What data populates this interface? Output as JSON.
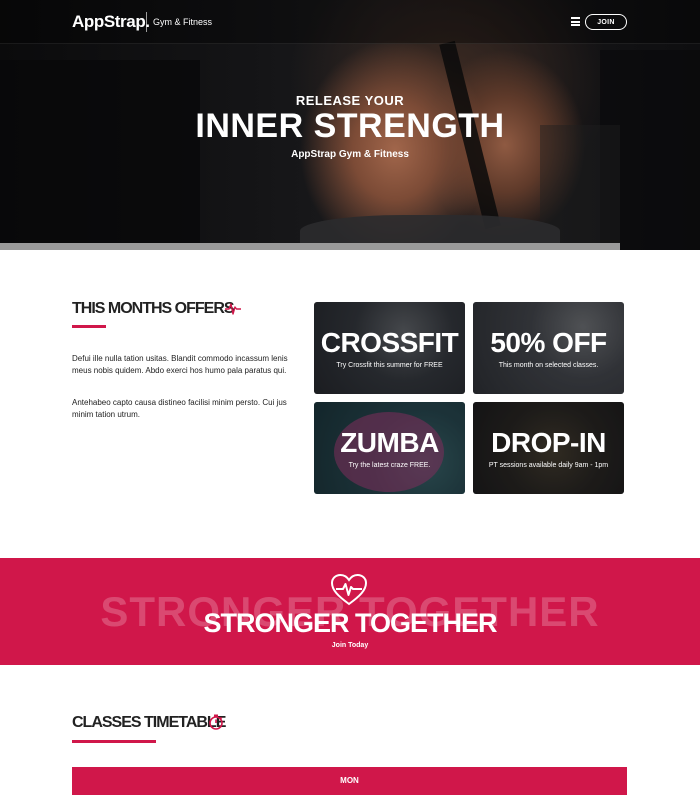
{
  "navbar": {
    "brand": "AppStrap.",
    "brand_sub": "Gym & Fitness",
    "join_label": "JOIN"
  },
  "hero": {
    "kicker": "RELEASE YOUR",
    "title": "INNER STRENGTH",
    "subtitle": "AppStrap Gym & Fitness"
  },
  "offers": {
    "heading": "THIS MONTHS OFFERS",
    "paragraphs": [
      "Defui ille nulla tation usitas. Blandit commodo incassum lenis meus nobis quidem. Abdo exerci hos humo pala paratus qui.",
      "Antehabeo capto causa distineo facilisi minim persto. Cui jus minim tation utrum."
    ],
    "tiles": [
      {
        "title": "CROSSFIT",
        "subtitle": "Try Crossfit this summer for FREE"
      },
      {
        "title": "50% OFF",
        "subtitle": "This month on selected classes."
      },
      {
        "title": "ZUMBA",
        "subtitle": "Try the latest craze FREE."
      },
      {
        "title": "DROP-IN",
        "subtitle": "PT sessions available daily 9am - 1pm"
      }
    ]
  },
  "band": {
    "ghost_text": "STRONGER TOGETHER",
    "title": "STRONGER TOGETHER",
    "cta": "Join Today"
  },
  "timetable": {
    "heading": "CLASSES TIMETABLE",
    "day": "MON"
  },
  "colors": {
    "accent": "#d0174a"
  },
  "icons": {
    "menu": "hamburger-icon",
    "offers": "heartbeat-pulse-icon",
    "band": "heart-pulse-icon",
    "timetable": "stopwatch-icon"
  }
}
